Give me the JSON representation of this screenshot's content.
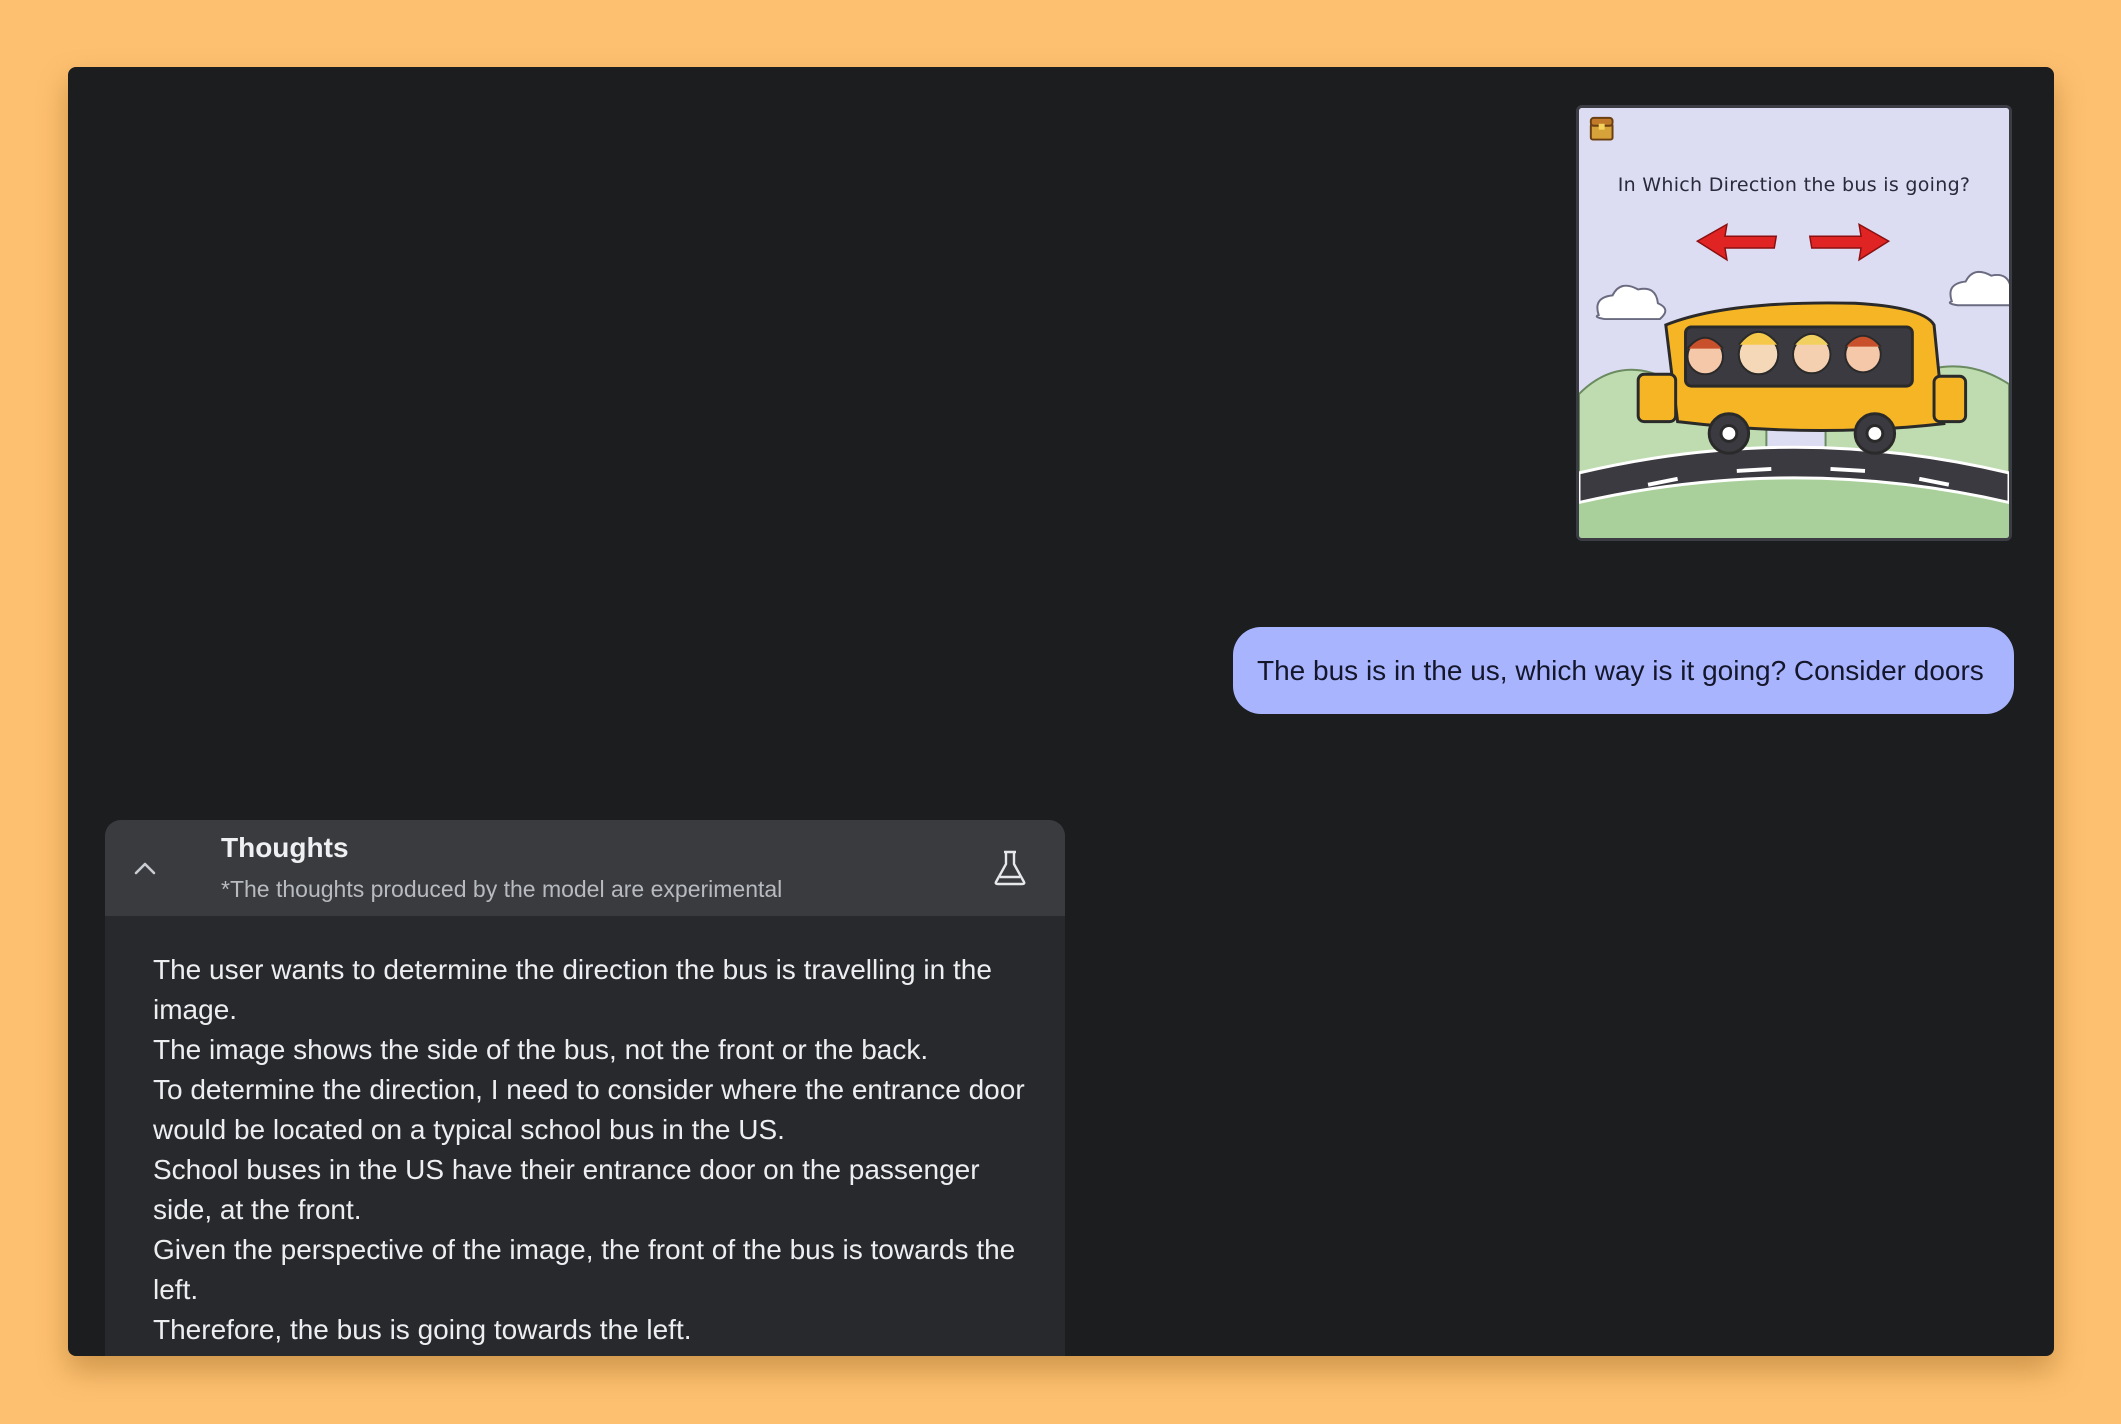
{
  "image": {
    "title": "In Which Direction the bus is going?",
    "icons": [
      "treasure-chest-icon",
      "arrow-left-icon",
      "arrow-right-icon"
    ],
    "colors": {
      "bus": "#f5b524",
      "arrows": "#e02424",
      "background": "#dcdcf3"
    }
  },
  "message": {
    "text": "The bus is in the us, which way is it going? Consider doors"
  },
  "thoughts": {
    "title": "Thoughts",
    "subtitle": "*The thoughts produced by the model are experimental",
    "lines": [
      "The user wants to determine the direction the bus is travelling in the image.",
      "The image shows the side of the bus, not the front or the back.",
      "To determine the direction, I need to consider where the entrance door would be located on a typical school bus in the US.",
      "School buses in the US have their entrance door on the passenger side, at the front.",
      "Given the perspective of the image, the front of the bus is towards the left.",
      "Therefore, the bus is going towards the left."
    ]
  },
  "colors": {
    "page_background": "#fdc070",
    "window_background": "#1b1d1f",
    "user_bubble": "#a9b4ff",
    "thoughts_header": "#393b3f",
    "thoughts_body": "#27292c"
  }
}
